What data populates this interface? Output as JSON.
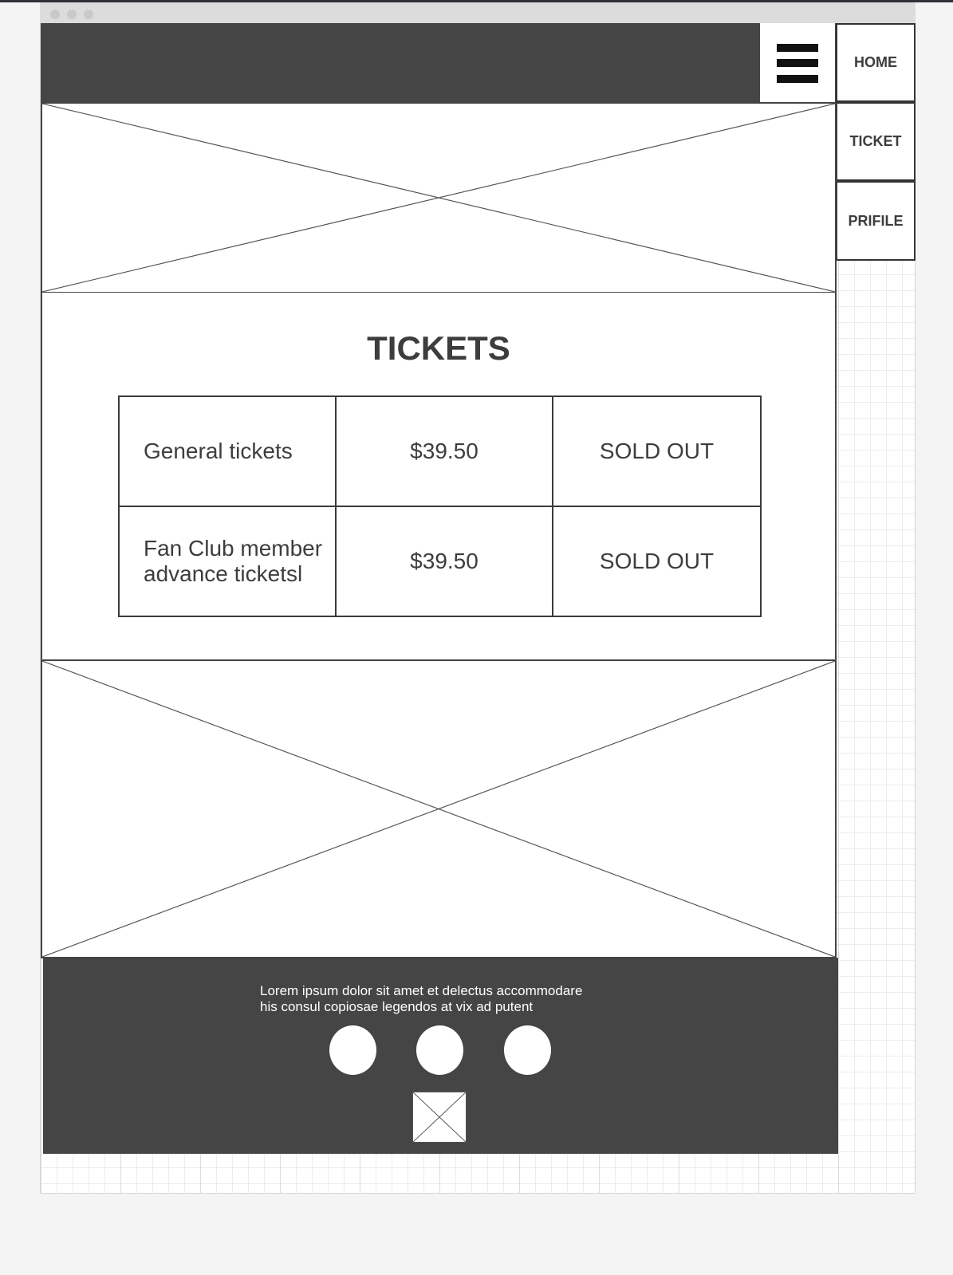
{
  "nav": {
    "items": [
      {
        "label": "HOME"
      },
      {
        "label": "TICKET"
      },
      {
        "label": "PRIFILE"
      }
    ]
  },
  "header": {
    "menu_icon": "hamburger-icon"
  },
  "tickets": {
    "title": "TICKETS",
    "rows": [
      {
        "name": "General tickets",
        "price": "$39.50",
        "status": "SOLD OUT"
      },
      {
        "name": "Fan Club member advance ticketsl",
        "price": "$39.50",
        "status": "SOLD OUT"
      }
    ]
  },
  "footer": {
    "text_line1": "Lorem ipsum dolor sit amet et delectus accommodare",
    "text_line2": "his consul copiosae legendos at vix ad putent",
    "social_icons": [
      "social-icon-1",
      "social-icon-2",
      "social-icon-3"
    ],
    "logo_icon": "image-placeholder-icon"
  },
  "colors": {
    "header_bg": "#454545",
    "footer_bg": "#454545",
    "border": "#333333"
  }
}
